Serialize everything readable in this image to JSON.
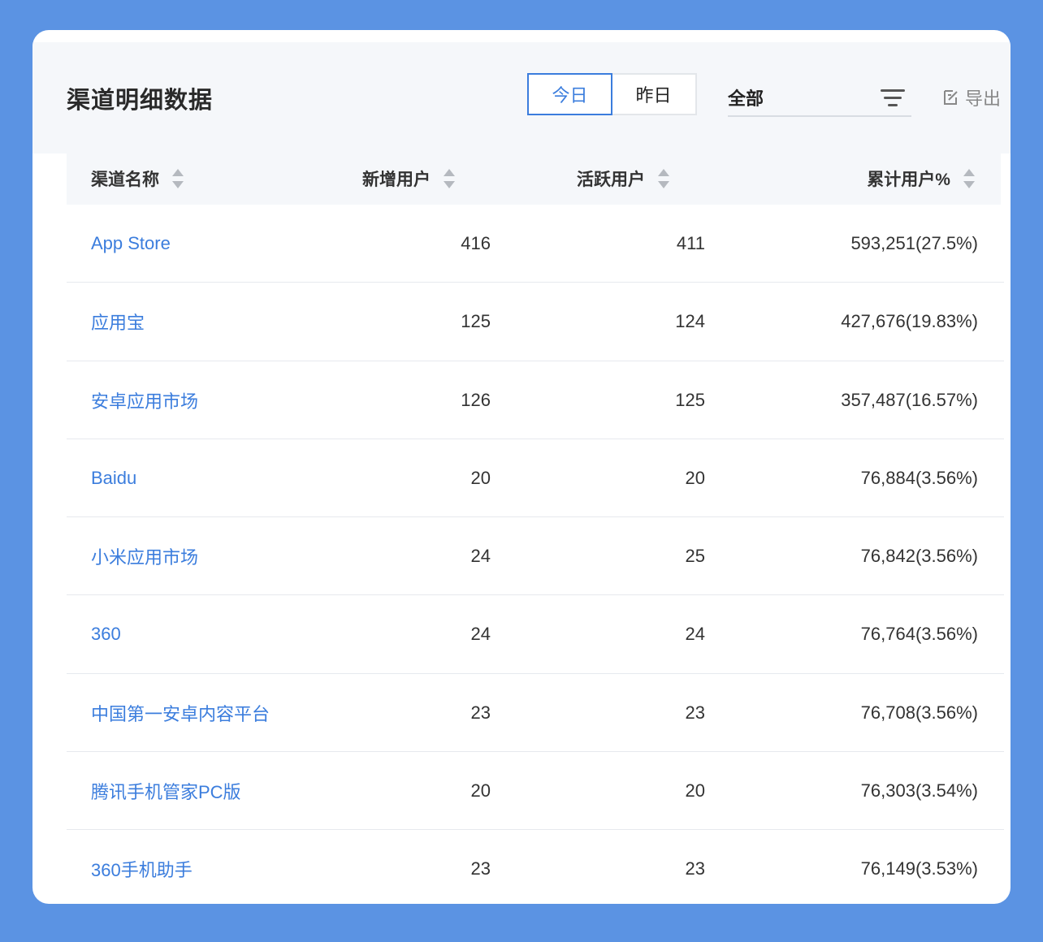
{
  "header": {
    "title": "渠道明细数据",
    "tabs": [
      {
        "label": "今日",
        "active": true
      },
      {
        "label": "昨日",
        "active": false
      }
    ],
    "select": {
      "value": "全部",
      "icon": "filter-icon"
    },
    "export": {
      "label": "导出",
      "icon": "export-icon"
    }
  },
  "table": {
    "columns": [
      {
        "label": "渠道名称"
      },
      {
        "label": "新增用户"
      },
      {
        "label": "活跃用户"
      },
      {
        "label": "累计用户%"
      }
    ],
    "rows": [
      {
        "name": "App Store",
        "new": "416",
        "active": "411",
        "total": "593,251(27.5%)"
      },
      {
        "name": "应用宝",
        "new": "125",
        "active": "124",
        "total": "427,676(19.83%)"
      },
      {
        "name": "安卓应用市场",
        "new": "126",
        "active": "125",
        "total": "357,487(16.57%)"
      },
      {
        "name": "Baidu",
        "new": "20",
        "active": "20",
        "total": "76,884(3.56%)"
      },
      {
        "name": "小米应用市场",
        "new": "24",
        "active": "25",
        "total": "76,842(3.56%)"
      },
      {
        "name": "360",
        "new": "24",
        "active": "24",
        "total": "76,764(3.56%)"
      },
      {
        "name": "中国第一安卓内容平台",
        "new": "23",
        "active": "23",
        "total": "76,708(3.56%)"
      },
      {
        "name": "腾讯手机管家PC版",
        "new": "20",
        "active": "20",
        "total": "76,303(3.54%)"
      },
      {
        "name": "360手机助手",
        "new": "23",
        "active": "23",
        "total": "76,149(3.53%)"
      }
    ]
  },
  "colors": {
    "accent": "#3b7ddd",
    "background": "#5b93e3",
    "header_bg": "#f5f7fa"
  }
}
